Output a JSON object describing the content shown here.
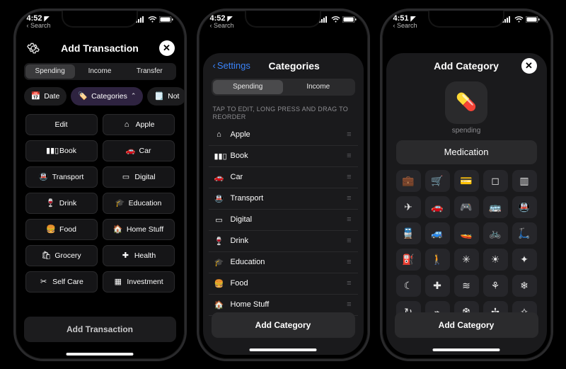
{
  "status": {
    "time1": "4:52",
    "time2": "4:52",
    "time3": "4:51",
    "back_search": "Search"
  },
  "p1": {
    "title": "Add Transaction",
    "seg": [
      "Spending",
      "Income",
      "Transfer"
    ],
    "seg_active": 0,
    "chips": [
      {
        "icon": "📅",
        "label": "Date",
        "sel": false
      },
      {
        "icon": "🏷️",
        "label": "Categories",
        "sel": true,
        "chev": true
      },
      {
        "icon": "🗒️",
        "label": "Not",
        "sel": false
      }
    ],
    "grid": [
      {
        "icon": "",
        "label": "Edit"
      },
      {
        "icon": "⌂",
        "label": "Apple"
      },
      {
        "icon": "▮▮▯",
        "label": "Book"
      },
      {
        "icon": "🚗",
        "label": "Car"
      },
      {
        "icon": "🚇",
        "label": "Transport"
      },
      {
        "icon": "▭",
        "label": "Digital"
      },
      {
        "icon": "🍷",
        "label": "Drink"
      },
      {
        "icon": "🎓",
        "label": "Education"
      },
      {
        "icon": "🍔",
        "label": "Food"
      },
      {
        "icon": "🏠",
        "label": "Home Stuff"
      },
      {
        "icon": "🛍",
        "label": "Grocery"
      },
      {
        "icon": "✚",
        "label": "Health"
      },
      {
        "icon": "✂",
        "label": "Self Care"
      },
      {
        "icon": "▦",
        "label": "Investment"
      }
    ],
    "footer": "Add Transaction"
  },
  "p2": {
    "back": "Settings",
    "title": "Categories",
    "seg": [
      "Spending",
      "Income"
    ],
    "seg_active": 0,
    "hint": "TAP TO EDIT, LONG PRESS AND DRAG TO REORDER",
    "rows": [
      {
        "icon": "⌂",
        "label": "Apple"
      },
      {
        "icon": "▮▮▯",
        "label": "Book"
      },
      {
        "icon": "🚗",
        "label": "Car"
      },
      {
        "icon": "🚇",
        "label": "Transport"
      },
      {
        "icon": "▭",
        "label": "Digital"
      },
      {
        "icon": "🍷",
        "label": "Drink"
      },
      {
        "icon": "🎓",
        "label": "Education"
      },
      {
        "icon": "🍔",
        "label": "Food"
      },
      {
        "icon": "🏠",
        "label": "Home Stuff"
      }
    ],
    "footer": "Add Category"
  },
  "p3": {
    "title": "Add Category",
    "sub": "spending",
    "name": "Medication",
    "sel_icon": "💊",
    "icons": [
      "💼",
      "🛒",
      "💳",
      "◻︎",
      "▥",
      "✈",
      "🚗",
      "🎮",
      "🚌",
      "🚇",
      "🚆",
      "🚙",
      "🚤",
      "🚲",
      "🛴",
      "⛽",
      "🚶",
      "✳",
      "☀",
      "✦",
      "☾",
      "✚",
      "≋",
      "⚘",
      "❄",
      "↻",
      "⌁",
      "❆",
      "✢",
      "✧"
    ],
    "footer": "Add Category"
  }
}
